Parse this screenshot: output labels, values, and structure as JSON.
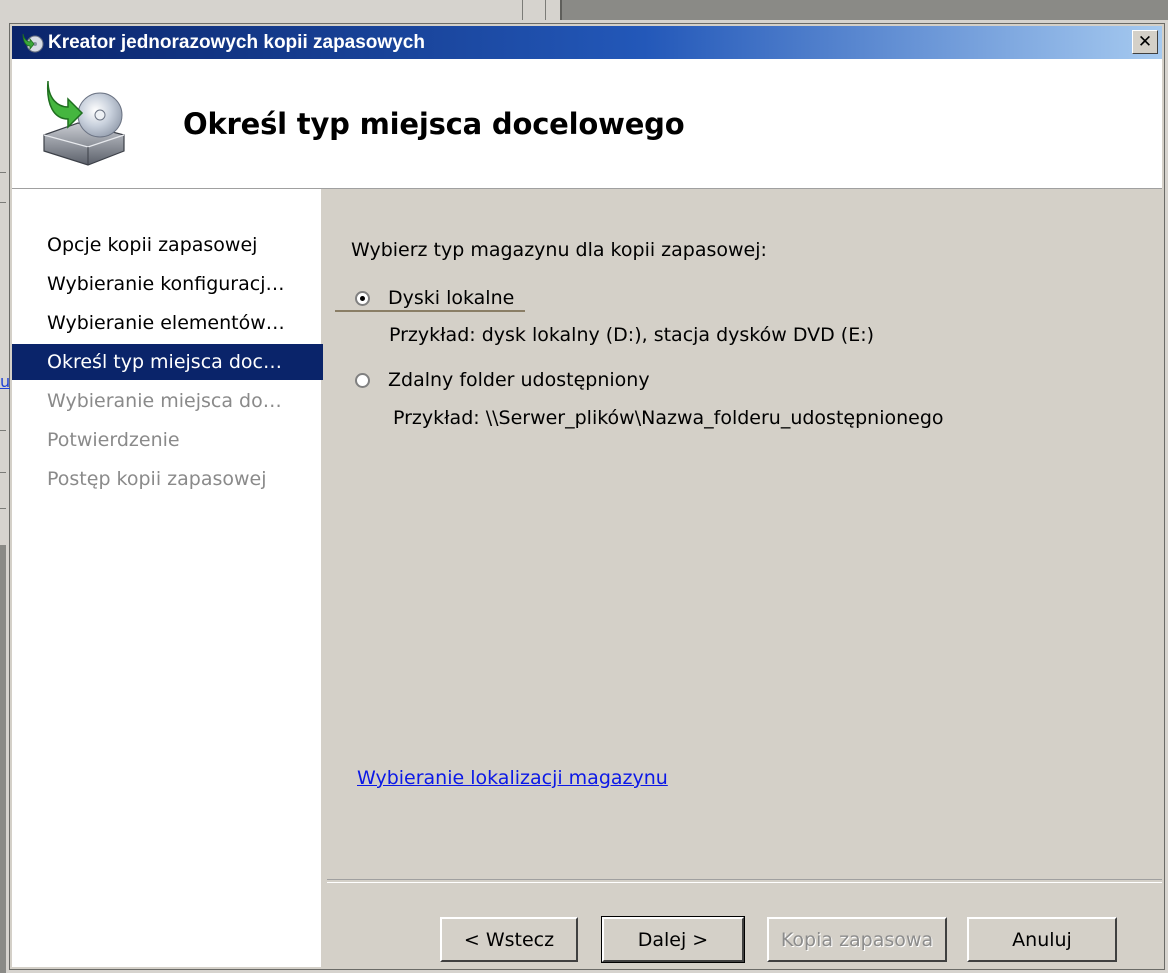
{
  "window": {
    "title": "Kreator jednorazowych kopii zapasowych",
    "close_glyph": "✕"
  },
  "header": {
    "title": "Określ typ miejsca docelowego",
    "icon": "backup-disk-icon"
  },
  "sidebar": {
    "items": [
      {
        "label": "Opcje kopii zapasowej",
        "state": "normal"
      },
      {
        "label": "Wybieranie konfiguracj…",
        "state": "normal"
      },
      {
        "label": "Wybieranie elementów…",
        "state": "normal"
      },
      {
        "label": "Określ typ miejsca doc…",
        "state": "active"
      },
      {
        "label": "Wybieranie miejsca do…",
        "state": "disabled"
      },
      {
        "label": "Potwierdzenie",
        "state": "disabled"
      },
      {
        "label": "Postęp kopii zapasowej",
        "state": "disabled"
      }
    ]
  },
  "main": {
    "prompt": "Wybierz typ magazynu dla kopii zapasowej:",
    "options": [
      {
        "label": "Dyski lokalne",
        "checked": true,
        "example": "Przykład: dysk lokalny (D:), stacja dysków DVD (E:)"
      },
      {
        "label": "Zdalny folder udostępniony",
        "checked": false,
        "example": "Przykład: \\\\Serwer_plików\\Nazwa_folderu_udostępnionego"
      }
    ],
    "help_link": "Wybieranie lokalizacji magazynu"
  },
  "buttons": {
    "back": "< Wstecz",
    "next": "Dalej >",
    "backup": "Kopia zapasowa",
    "cancel": "Anuluj"
  },
  "colors": {
    "titlebar_start": "#0a246a",
    "selection": "#0a246a",
    "link": "#0b18e6",
    "dialog_bg": "#d4d0c8"
  }
}
